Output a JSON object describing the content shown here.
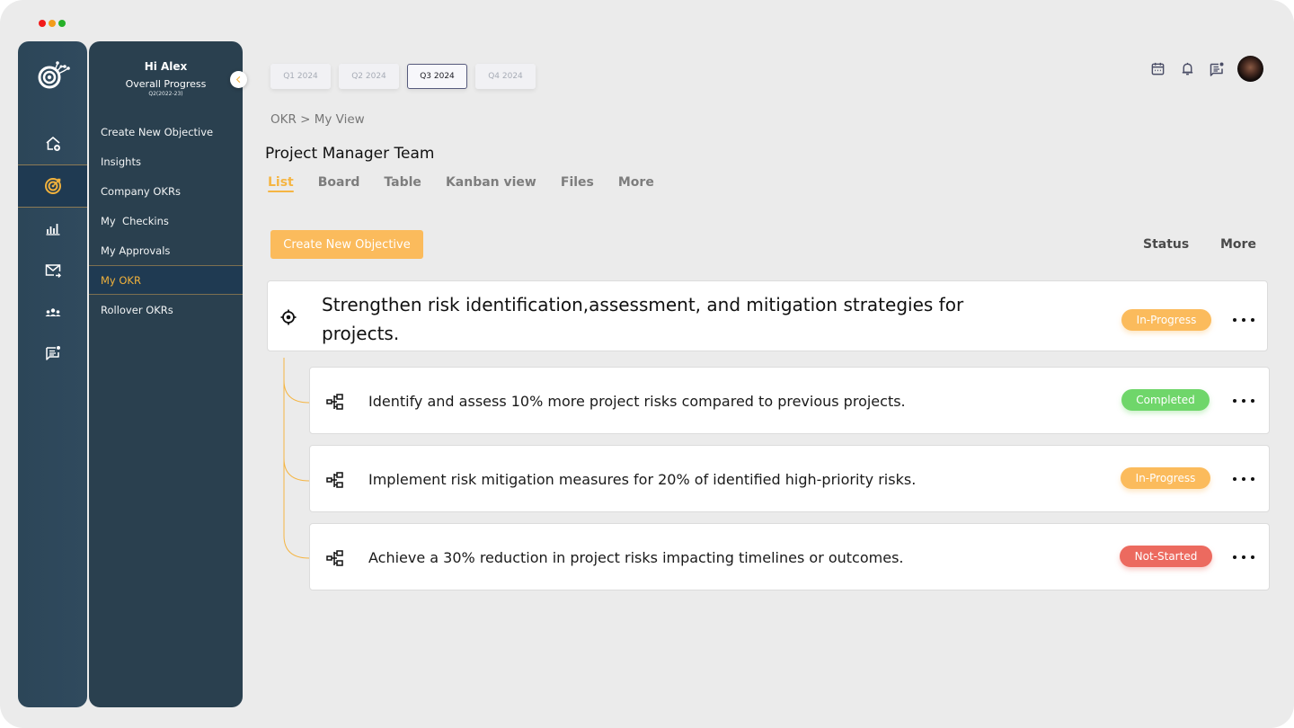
{
  "window": {
    "traffic_lights": [
      "close",
      "minimize",
      "maximize"
    ]
  },
  "rail": {
    "logo": "target-logo-icon",
    "items": [
      {
        "icon": "home-add-icon",
        "active": false
      },
      {
        "icon": "target-icon",
        "active": true
      },
      {
        "icon": "bar-chart-icon",
        "active": false
      },
      {
        "icon": "mail-forward-icon",
        "active": false
      },
      {
        "icon": "team-icon",
        "active": false
      },
      {
        "icon": "chat-notification-icon",
        "active": false
      }
    ]
  },
  "menu": {
    "greeting": "Hi Alex",
    "progress_label": "Overall Progress",
    "period": "Q2(2022-23)",
    "items": [
      {
        "label": "Create New Objective",
        "active": false
      },
      {
        "label": "Insights",
        "active": false
      },
      {
        "label": "Company OKRs",
        "active": false
      },
      {
        "label": "My  Checkins",
        "active": false
      },
      {
        "label": "My Approvals",
        "active": false
      },
      {
        "label": "My OKR",
        "active": true
      },
      {
        "label": "Rollover OKRs",
        "active": false
      }
    ]
  },
  "quarters": [
    {
      "label": "Q1 2024",
      "active": false
    },
    {
      "label": "Q2 2024",
      "active": false
    },
    {
      "label": "Q3 2024",
      "active": true
    },
    {
      "label": "Q4 2024",
      "active": false
    }
  ],
  "header_icons": [
    "calendar-icon",
    "bell-icon",
    "chat-icon",
    "avatar"
  ],
  "breadcrumb": "OKR > My View",
  "page_title": "Project Manager Team",
  "tabs": [
    {
      "label": "List",
      "active": true
    },
    {
      "label": "Board",
      "active": false
    },
    {
      "label": "Table",
      "active": false
    },
    {
      "label": "Kanban view",
      "active": false
    },
    {
      "label": "Files",
      "active": false
    },
    {
      "label": "More",
      "active": false
    }
  ],
  "toolbar": {
    "create_label": "Create New Objective",
    "status_header": "Status",
    "more_header": "More"
  },
  "status_colors": {
    "In-Progress": "#fbbb5c",
    "Completed": "#6fd66a",
    "Not-Started": "#ec6a5f"
  },
  "objective": {
    "title": "Strengthen risk identification,assessment, and mitigation strategies for projects.",
    "status": "In-Progress",
    "key_results": [
      {
        "title": "Identify and assess 10% more project risks compared to previous projects.",
        "status": "Completed"
      },
      {
        "title": "Implement risk mitigation measures for 20% of identified high-priority risks.",
        "status": "In-Progress"
      },
      {
        "title": "Achieve a 30% reduction in project risks impacting timelines or outcomes.",
        "status": "Not-Started"
      }
    ]
  }
}
